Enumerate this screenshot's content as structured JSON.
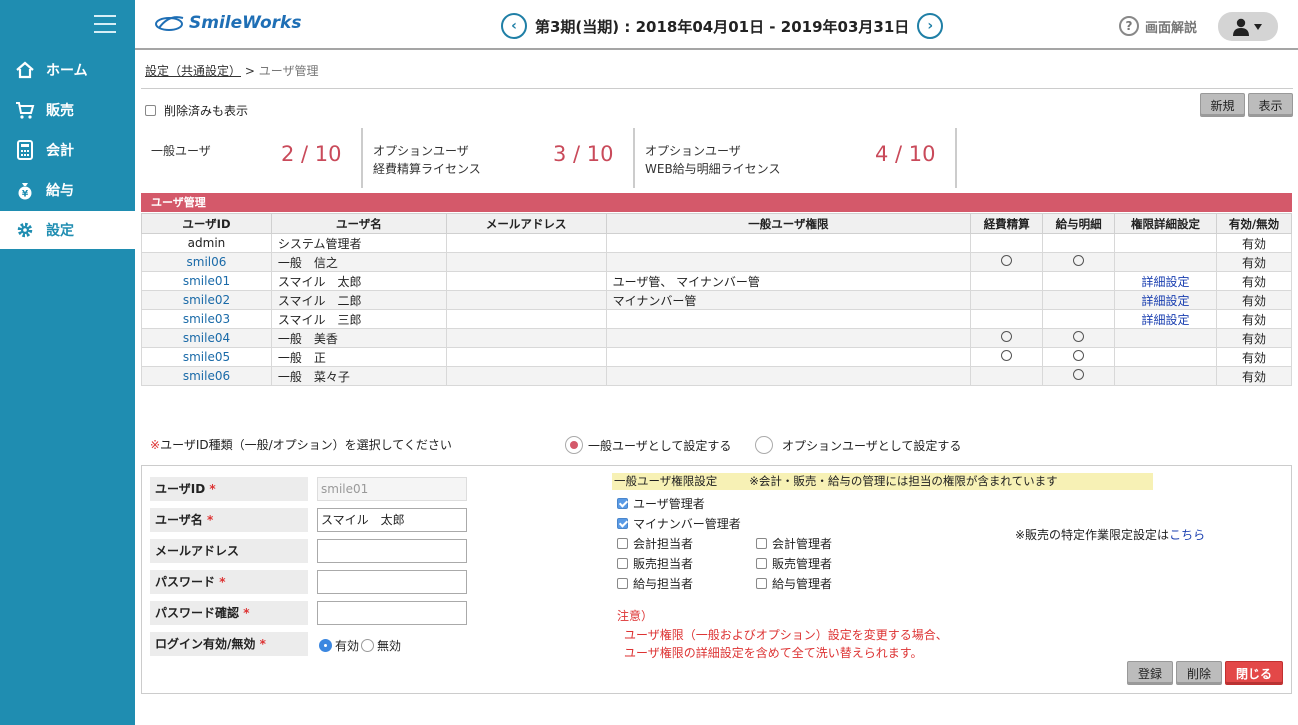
{
  "app": {
    "logo_text": "SmileWorks"
  },
  "sidebar": {
    "items": [
      {
        "label": "ホーム",
        "icon": "home-icon"
      },
      {
        "label": "販売",
        "icon": "cart-icon"
      },
      {
        "label": "会計",
        "icon": "calculator-icon"
      },
      {
        "label": "給与",
        "icon": "money-bag-icon"
      },
      {
        "label": "設定",
        "icon": "gear-icon"
      }
    ]
  },
  "header": {
    "period": "第3期(当期) : 2018年04月01日 - 2019年03月31日",
    "help_label": "画面解説",
    "prev_icon": "‹",
    "next_icon": "›"
  },
  "breadcrumb": {
    "parent": "設定（共通設定）",
    "separator": " > ",
    "current": "ユーザ管理"
  },
  "filters": {
    "show_deleted_label": "削除済みも表示"
  },
  "toolbar": {
    "new_label": "新規",
    "show_label": "表示"
  },
  "licenses": [
    {
      "label1": "一般ユーザ",
      "label2": "",
      "value": "2 / 10"
    },
    {
      "label1": "オプションユーザ",
      "label2": "経費精算ライセンス",
      "value": "3 / 10"
    },
    {
      "label1": "オプションユーザ",
      "label2": "WEB給与明細ライセンス",
      "value": "4 / 10"
    }
  ],
  "table": {
    "title": "ユーザ管理",
    "headers": [
      "ユーザID",
      "ユーザ名",
      "メールアドレス",
      "一般ユーザ権限",
      "経費精算",
      "給与明細",
      "権限詳細設定",
      "有効/無効"
    ],
    "rows": [
      {
        "id": "admin",
        "name": "システム管理者",
        "email": "",
        "perm": "",
        "expense": "",
        "payslip": "",
        "detail": "",
        "status": "有効"
      },
      {
        "id": "smil06",
        "name": "一般　信之",
        "email": "",
        "perm": "",
        "expense": "○",
        "payslip": "○",
        "detail": "",
        "status": "有効"
      },
      {
        "id": "smile01",
        "name": "スマイル　太郎",
        "email": "",
        "perm": "ユーザ管、 マイナンバー管",
        "expense": "",
        "payslip": "",
        "detail": "詳細設定",
        "status": "有効"
      },
      {
        "id": "smile02",
        "name": "スマイル　二郎",
        "email": "",
        "perm": "マイナンバー管",
        "expense": "",
        "payslip": "",
        "detail": "詳細設定",
        "status": "有効"
      },
      {
        "id": "smile03",
        "name": "スマイル　三郎",
        "email": "",
        "perm": "",
        "expense": "",
        "payslip": "",
        "detail": "詳細設定",
        "status": "有効"
      },
      {
        "id": "smile04",
        "name": "一般　美香",
        "email": "",
        "perm": "",
        "expense": "○",
        "payslip": "○",
        "detail": "",
        "status": "有効"
      },
      {
        "id": "smile05",
        "name": "一般　正",
        "email": "",
        "perm": "",
        "expense": "○",
        "payslip": "○",
        "detail": "",
        "status": "有効"
      },
      {
        "id": "smile06",
        "name": "一般　菜々子",
        "email": "",
        "perm": "",
        "expense": "",
        "payslip": "○",
        "detail": "",
        "status": "有効"
      }
    ]
  },
  "type_select": {
    "mark": "※",
    "instruction": "ユーザID種類（一般/オプション）を選択してください",
    "general_label": "一般ユーザとして設定する",
    "option_label": "オプションユーザとして設定する"
  },
  "form": {
    "userid_label": "ユーザID",
    "userid_value": "smile01",
    "username_label": "ユーザ名",
    "username_value": "スマイル　太郎",
    "email_label": "メールアドレス",
    "email_value": "",
    "password_label": "パスワード",
    "password_value": "",
    "password_confirm_label": "パスワード確認",
    "password_confirm_value": "",
    "login_label": "ログイン有効/無効",
    "enabled_label": "有効",
    "disabled_label": "無効",
    "required_mark": "*"
  },
  "permissions": {
    "title": "一般ユーザ権限設定",
    "title_note": "※会計・販売・給与の管理には担当の権限が含まれています",
    "items": [
      {
        "label": "ユーザ管理者",
        "checked": true
      },
      {
        "label": "マイナンバー管理者",
        "checked": true
      },
      {
        "label": "会計担当者",
        "checked": false
      },
      {
        "label": "会計管理者",
        "checked": false
      },
      {
        "label": "販売担当者",
        "checked": false
      },
      {
        "label": "販売管理者",
        "checked": false
      },
      {
        "label": "給与担当者",
        "checked": false
      },
      {
        "label": "給与管理者",
        "checked": false
      }
    ],
    "sales_note": "※販売の特定作業限定設定は",
    "sales_link": "こちら",
    "warning_title": "注意）",
    "warning_line1": "ユーザ権限（一般およびオプション）設定を変更する場合、",
    "warning_line2": "ユーザ権限の詳細設定を含めて全て洗い替えられます。"
  },
  "actions": {
    "register_label": "登録",
    "delete_label": "削除",
    "close_label": "閉じる"
  },
  "colors": {
    "sidebar": "#1f8db1",
    "accent": "#d4596a",
    "close_button": "#e34848"
  }
}
